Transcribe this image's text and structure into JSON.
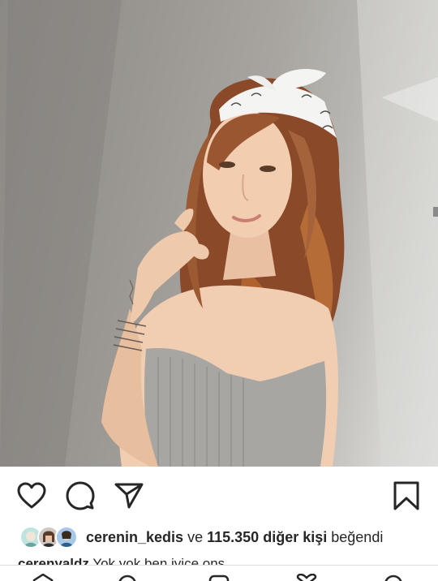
{
  "post": {
    "photo_alt": "",
    "liked_by": {
      "first_user": "cerenin_kedis",
      "connector_1": "ve",
      "count": "115.350",
      "others_label": "diğer kişi",
      "suffix": "beğendi"
    },
    "caption": {
      "username": "cerenyaldz",
      "text": "Yok yok ben iyice ons…"
    }
  },
  "actions": {
    "like_icon": "heart-outline-icon",
    "comment_icon": "comment-bubble-icon",
    "share_icon": "paper-plane-icon",
    "save_icon": "bookmark-outline-icon"
  },
  "colors": {
    "text": "#262626",
    "border": "#dbdbdb",
    "background": "#ffffff"
  }
}
